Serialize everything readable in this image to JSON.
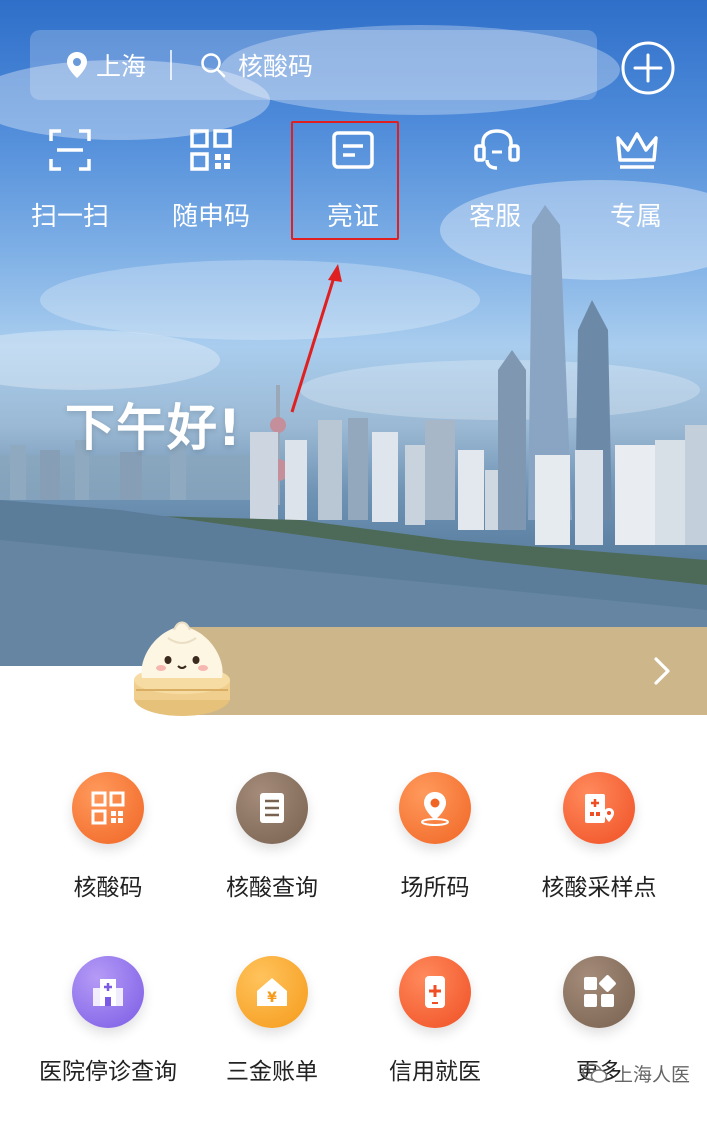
{
  "header": {
    "location": "上海",
    "search_placeholder": "核酸码"
  },
  "quick_actions": [
    {
      "label": "扫一扫",
      "icon": "scan-icon"
    },
    {
      "label": "随申码",
      "icon": "qrcode-icon"
    },
    {
      "label": "亮证",
      "icon": "id-card-icon",
      "highlighted": true
    },
    {
      "label": "客服",
      "icon": "customer-service-icon"
    },
    {
      "label": "专属",
      "icon": "crown-icon"
    }
  ],
  "greeting": "下午好!",
  "services": [
    {
      "label": "核酸码",
      "icon": "qrcode-icon",
      "color": "#f06524"
    },
    {
      "label": "核酸查询",
      "icon": "document-icon",
      "color": "#78614f"
    },
    {
      "label": "场所码",
      "icon": "location-pin-icon",
      "color": "#f06524"
    },
    {
      "label": "核酸采样点",
      "icon": "building-pin-icon",
      "color": "#ef4f24"
    },
    {
      "label": "医院停诊查询",
      "icon": "hospital-icon",
      "color": "#7b5be5"
    },
    {
      "label": "三金账单",
      "icon": "house-yen-icon",
      "color": "#f59a1a"
    },
    {
      "label": "信用就医",
      "icon": "phone-plus-icon",
      "color": "#ef4f24"
    },
    {
      "label": "更多",
      "icon": "more-apps-icon",
      "color": "#78614f"
    }
  ],
  "watermark": "上海人医",
  "colors": {
    "accent_orange": "#f06524",
    "banner_gold": "#cdb68a",
    "highlight_red": "#e02020"
  }
}
